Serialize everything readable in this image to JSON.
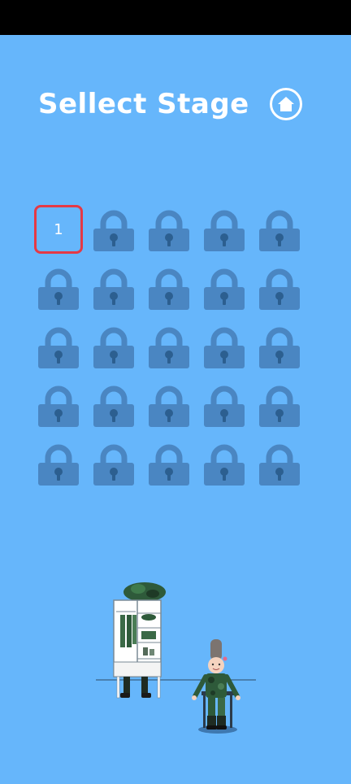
{
  "title": "Sellect Stage",
  "home_icon": "home-icon",
  "colors": {
    "background": "#66b6fb",
    "lock": "#4a86c2",
    "unlocked_border": "#e53945",
    "text": "#ffffff"
  },
  "stages": [
    {
      "label": "1",
      "locked": false
    },
    {
      "label": "",
      "locked": true
    },
    {
      "label": "",
      "locked": true
    },
    {
      "label": "",
      "locked": true
    },
    {
      "label": "",
      "locked": true
    },
    {
      "label": "",
      "locked": true
    },
    {
      "label": "",
      "locked": true
    },
    {
      "label": "",
      "locked": true
    },
    {
      "label": "",
      "locked": true
    },
    {
      "label": "",
      "locked": true
    },
    {
      "label": "",
      "locked": true
    },
    {
      "label": "",
      "locked": true
    },
    {
      "label": "",
      "locked": true
    },
    {
      "label": "",
      "locked": true
    },
    {
      "label": "",
      "locked": true
    },
    {
      "label": "",
      "locked": true
    },
    {
      "label": "",
      "locked": true
    },
    {
      "label": "",
      "locked": true
    },
    {
      "label": "",
      "locked": true
    },
    {
      "label": "",
      "locked": true
    },
    {
      "label": "",
      "locked": true
    },
    {
      "label": "",
      "locked": true
    },
    {
      "label": "",
      "locked": true
    },
    {
      "label": "",
      "locked": true
    },
    {
      "label": "",
      "locked": true
    }
  ]
}
